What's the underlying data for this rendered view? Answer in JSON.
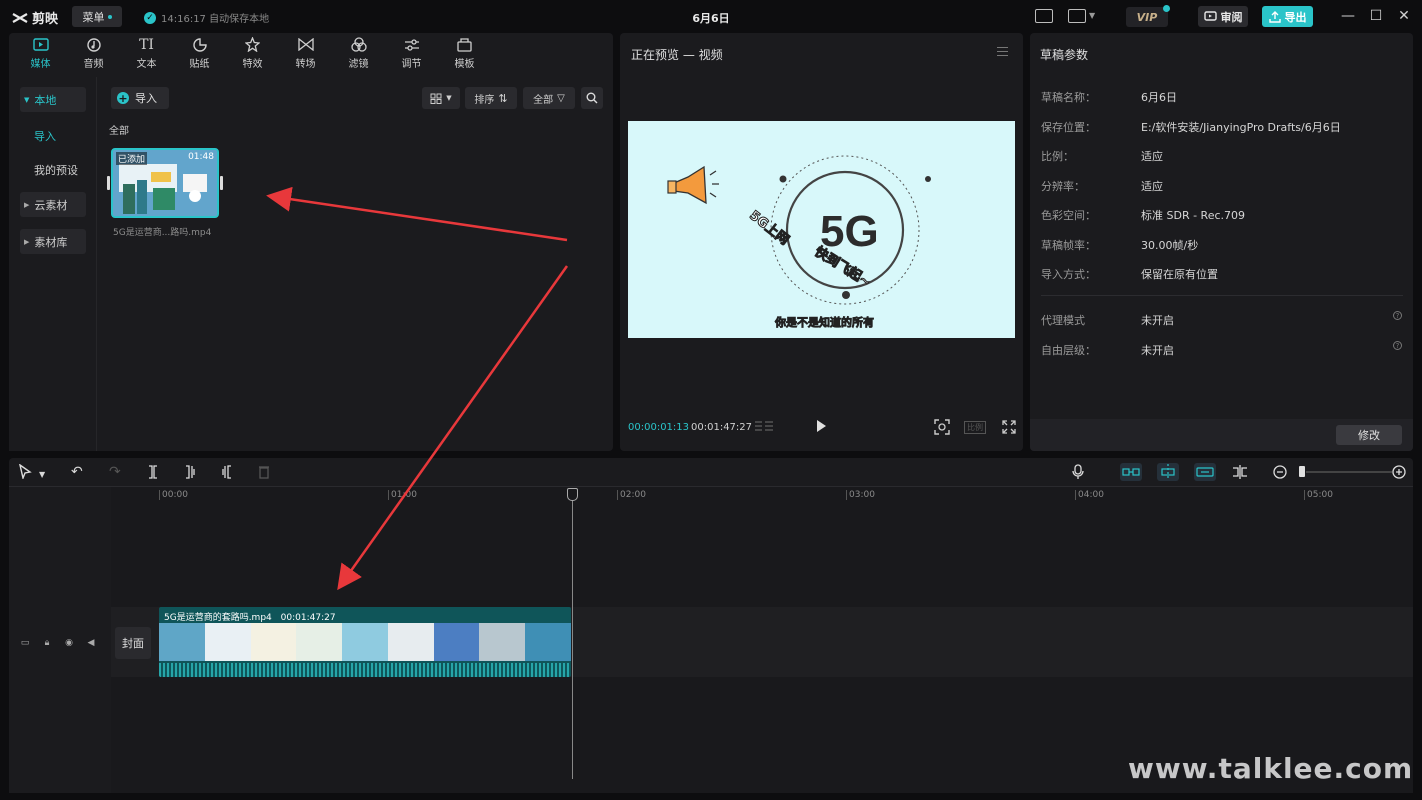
{
  "app": {
    "name": "剪映",
    "menu_label": "菜单",
    "save_status": "14:16:17 自动保存本地",
    "doc_title": "6月6日",
    "vip_label": "VIP",
    "review_label": "审阅",
    "export_label": "导出"
  },
  "media_tabs": [
    {
      "label": "媒体",
      "icon": "media-icon"
    },
    {
      "label": "音频",
      "icon": "audio-icon"
    },
    {
      "label": "文本",
      "icon": "text-icon"
    },
    {
      "label": "贴纸",
      "icon": "sticker-icon"
    },
    {
      "label": "特效",
      "icon": "effects-icon"
    },
    {
      "label": "转场",
      "icon": "transition-icon"
    },
    {
      "label": "滤镜",
      "icon": "filter-icon"
    },
    {
      "label": "调节",
      "icon": "adjust-icon"
    },
    {
      "label": "模板",
      "icon": "template-icon"
    }
  ],
  "sidebar": {
    "local": "本地",
    "import": "导入",
    "my_presets": "我的预设",
    "cloud": "云素材",
    "library": "素材库"
  },
  "library": {
    "import_label": "导入",
    "sort_label": "排序",
    "all_filter_label": "全部",
    "section_label": "全部",
    "item": {
      "badge": "已添加",
      "duration": "01:48",
      "name": "5G是运营商...路吗.mp4"
    }
  },
  "preview": {
    "title": "正在预览 — 视频",
    "current_time": "00:00:01:13",
    "total_time": "00:01:47:27",
    "ratio_label": "比例",
    "canvas_big_text": "5G",
    "canvas_left_text": "5G上网",
    "canvas_right_text": "快到飞起~",
    "canvas_caption": "你是不是知道的所有"
  },
  "params": {
    "title": "草稿参数",
    "rows": [
      {
        "label": "草稿名称：",
        "value": "6月6日"
      },
      {
        "label": "保存位置：",
        "value": "E:/软件安装/JianyingPro Drafts/6月6日"
      },
      {
        "label": "比例：",
        "value": "适应"
      },
      {
        "label": "分辨率：",
        "value": "适应"
      },
      {
        "label": "色彩空间：",
        "value": "标准 SDR - Rec.709"
      },
      {
        "label": "草稿帧率：",
        "value": "30.00帧/秒"
      },
      {
        "label": "导入方式：",
        "value": "保留在原有位置"
      }
    ],
    "rows2": [
      {
        "label": "代理模式",
        "value": "未开启"
      },
      {
        "label": "自由层级：",
        "value": "未开启"
      }
    ],
    "modify_label": "修改"
  },
  "timeline": {
    "ruler": [
      "00:00",
      "01:00",
      "02:00",
      "03:00",
      "04:00",
      "05:00"
    ],
    "clip_name": "5G是运营商的套路吗.mp4",
    "clip_duration": "00:01:47:27",
    "cover_label": "封面",
    "zoom_level": 0.1
  },
  "watermark": "www.talklee.com",
  "colors": {
    "accent": "#2ac4c9",
    "background": "#0d0d0f",
    "panel": "#1b1b1e",
    "annotation_arrow": "#e8383b"
  }
}
